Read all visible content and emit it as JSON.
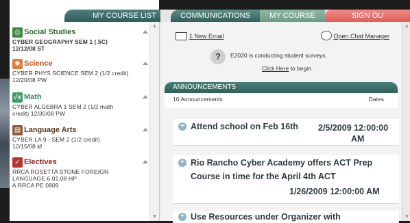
{
  "tabs": {
    "course_list": "MY COURSE LIST",
    "communications": "COMMUNICATIONS",
    "course_info": "MY COURSE INFO",
    "sign_out": "SIGN OU"
  },
  "subjects": [
    {
      "name": "Social Studies",
      "icon": "globe-icon",
      "color": "#3a8a3a",
      "courses": [
        "CYBER GEOGRAPHY SEM 1 (.5C)",
        "12/12/08 ST"
      ]
    },
    {
      "name": "Science",
      "icon": "atom-icon",
      "color": "#e07b39",
      "courses": [
        "CYBER PHYS SCIENCE SEM 2 (1/2 credit)",
        "12/20/08 PW"
      ]
    },
    {
      "name": "Math",
      "icon": "sqrt-icon",
      "color": "#3a9a6a",
      "courses": [
        "CYBER ALGEBRA 1 SEM 2 (1/2 math",
        "credit) 12/30/08 PW"
      ]
    },
    {
      "name": "Language Arts",
      "icon": "book-icon",
      "color": "#8a5a3a",
      "courses": [
        "CYBER LA 9 - SEM 2 (1/2 credit)",
        "12/15/08 kf"
      ]
    },
    {
      "name": "Electives",
      "icon": "check-icon",
      "color": "#c03030",
      "courses": [
        "RRCA ROSETTA STONE FOREIGN",
        "LANGUAGE 6.01.08 HP",
        "A RRCA PE 0809"
      ]
    }
  ],
  "comm": {
    "new_email": "1 New Email",
    "chat": "Open Chat Manager",
    "survey_text": "E2020 is conducting student surveys.",
    "survey_link": "Click Here",
    "survey_suffix": " to begin."
  },
  "announcements": {
    "header": "ANNOUNCEMENTS",
    "count": "10 Announcements",
    "dates_label": "Dates",
    "items": [
      {
        "title": "Attend school on Feb 16th",
        "date_a": "2/5/2009 12:00:00",
        "date_b": "AM"
      },
      {
        "title": "Rio Rancho Cyber Academy offers ACT Prep",
        "title_2": "Course in time for the April 4th ACT",
        "date": "1/26/2009 12:00:00 AM"
      },
      {
        "title": "Use Resources under Organizer with"
      }
    ]
  }
}
